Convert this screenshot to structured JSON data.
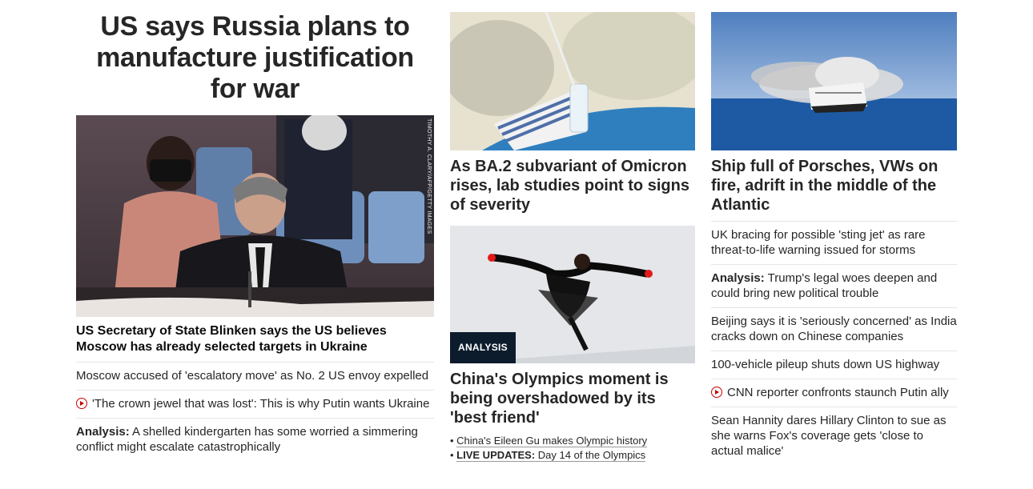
{
  "col1": {
    "banner": "US says Russia plans to manufacture justification for war",
    "image_credit": "TIMOTHY A. CLARY/AFP/GETTY IMAGES",
    "lead_headline": "US Secretary of State Blinken says the US believes Moscow has already selected targets in Ukraine",
    "items": [
      {
        "prefix": "",
        "text": "Moscow accused of 'escalatory move' as No. 2 US envoy expelled",
        "icon": ""
      },
      {
        "prefix": "",
        "text": "'The crown jewel that was lost': This is why Putin wants Ukraine",
        "icon": "play-icon"
      },
      {
        "prefix": "Analysis:",
        "text": "A shelled kindergarten has some worried a simmering conflict might escalate catastrophically",
        "icon": ""
      }
    ]
  },
  "col2": {
    "card1_headline": "As BA.2 subvariant of Omicron rises, lab studies point to signs of severity",
    "badge": "ANALYSIS",
    "card2_headline": "China's Olympics moment is being overshadowed by its 'best friend'",
    "sub1": "China's Eileen Gu makes Olympic history",
    "sub2_prefix": "LIVE UPDATES:",
    "sub2_text": "Day 14 of the Olympics"
  },
  "col3": {
    "headline": "Ship full of Porsches, VWs on fire, adrift in the middle of the Atlantic",
    "items": [
      {
        "prefix": "",
        "text": "UK bracing for possible 'sting jet' as rare threat-to-life warning issued for storms",
        "icon": ""
      },
      {
        "prefix": "Analysis:",
        "text": "Trump's legal woes deepen and could bring new political trouble",
        "icon": ""
      },
      {
        "prefix": "",
        "text": "Beijing says it is 'seriously concerned' as India cracks down on Chinese companies",
        "icon": ""
      },
      {
        "prefix": "",
        "text": "100-vehicle pileup shuts down US highway",
        "icon": ""
      },
      {
        "prefix": "",
        "text": "CNN reporter confronts staunch Putin ally",
        "icon": "play-icon"
      },
      {
        "prefix": "",
        "text": "Sean Hannity dares Hillary Clinton to sue as she warns Fox's coverage gets 'close to actual malice'",
        "icon": ""
      }
    ]
  }
}
